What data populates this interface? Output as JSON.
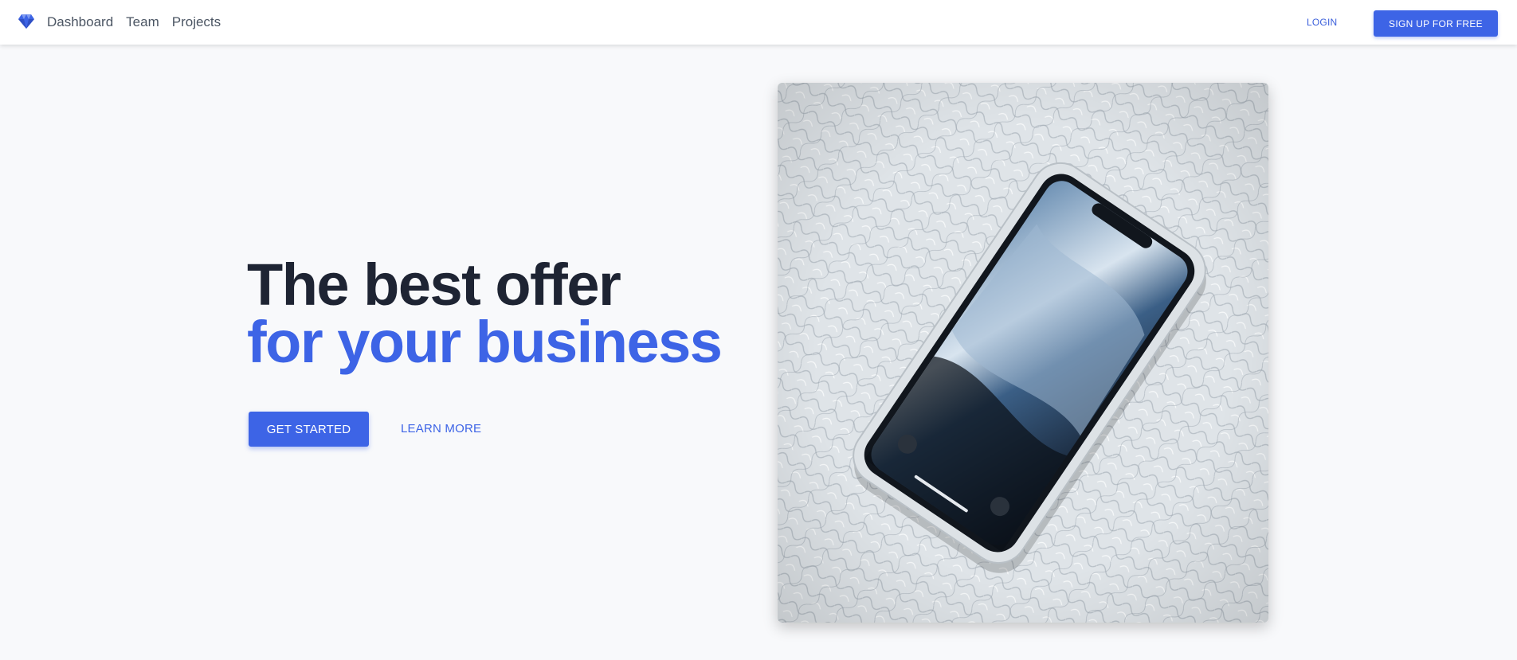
{
  "nav": {
    "links": [
      "Dashboard",
      "Team",
      "Projects"
    ],
    "login_label": "LOGIN",
    "signup_label": "SIGN UP FOR FREE"
  },
  "hero": {
    "title_line1": "The best offer",
    "title_line2": "for your business",
    "primary_label": "GET STARTED",
    "secondary_label": "LEARN MORE"
  },
  "colors": {
    "accent": "#3d64e6",
    "heading": "#1e2433",
    "background": "#f8f9fb"
  },
  "icons": {
    "brand": "diamond-icon"
  }
}
